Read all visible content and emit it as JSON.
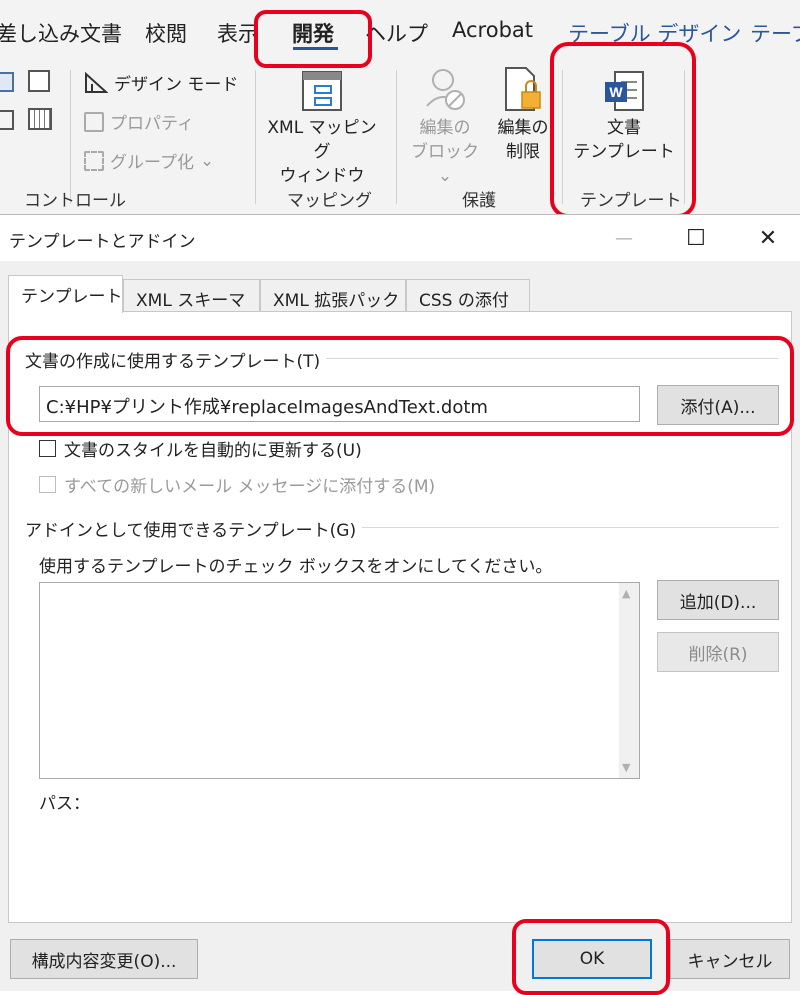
{
  "ribbon": {
    "tabs": [
      {
        "label": "差し込み文書",
        "kind": "normal"
      },
      {
        "label": "校閲",
        "kind": "normal"
      },
      {
        "label": "表示",
        "kind": "normal"
      },
      {
        "label": "開発",
        "kind": "active"
      },
      {
        "label": "ヘルプ",
        "kind": "normal"
      },
      {
        "label": "Acrobat",
        "kind": "normal"
      },
      {
        "label": "テーブル デザイン",
        "kind": "link"
      },
      {
        "label": "テーブ",
        "kind": "link"
      }
    ],
    "controls_group": {
      "design_mode": "デザイン モード",
      "properties": "プロパティ",
      "group": "グループ化",
      "group_chevron": "⌄",
      "label": "コントロール"
    },
    "mapping_group": {
      "xml_mapping_line1": "XML マッピング",
      "xml_mapping_line2": "ウィンドウ",
      "label": "マッピング"
    },
    "protect_group": {
      "block_line1": "編集の",
      "block_line2": "ブロック ⌄",
      "restrict_line1": "編集の",
      "restrict_line2": "制限",
      "label": "保護"
    },
    "template_group": {
      "doc_template_line1": "文書",
      "doc_template_line2": "テンプレート",
      "label": "テンプレート"
    }
  },
  "dialog": {
    "title": "テンプレートとアドイン",
    "minimize_glyph": "—",
    "maximize_glyph": "☐",
    "close_glyph": "✕",
    "tabs": [
      "テンプレート",
      "XML スキーマ",
      "XML 拡張パック",
      "CSS の添付"
    ],
    "doc_template_section": "文書の作成に使用するテンプレート(T)",
    "template_path": "C:¥HP¥プリント作成¥replaceImagesAndText.dotm",
    "attach_button": "添付(A)...",
    "auto_update_label": "文書のスタイルを自動的に更新する(U)",
    "attach_all_email_label": "すべての新しいメール メッセージに添付する(M)",
    "addin_section": "アドインとして使用できるテンプレート(G)",
    "addin_instruction": "使用するテンプレートのチェック ボックスをオンにしてください。",
    "add_button": "追加(D)...",
    "remove_button": "削除(R)",
    "path_label": "パス：",
    "organizer_button": "構成内容変更(O)...",
    "ok_button": "OK",
    "cancel_button": "キャンセル"
  },
  "colors": {
    "highlight": "#e8001c",
    "accent": "#2b579a",
    "link": "#2b5797"
  }
}
